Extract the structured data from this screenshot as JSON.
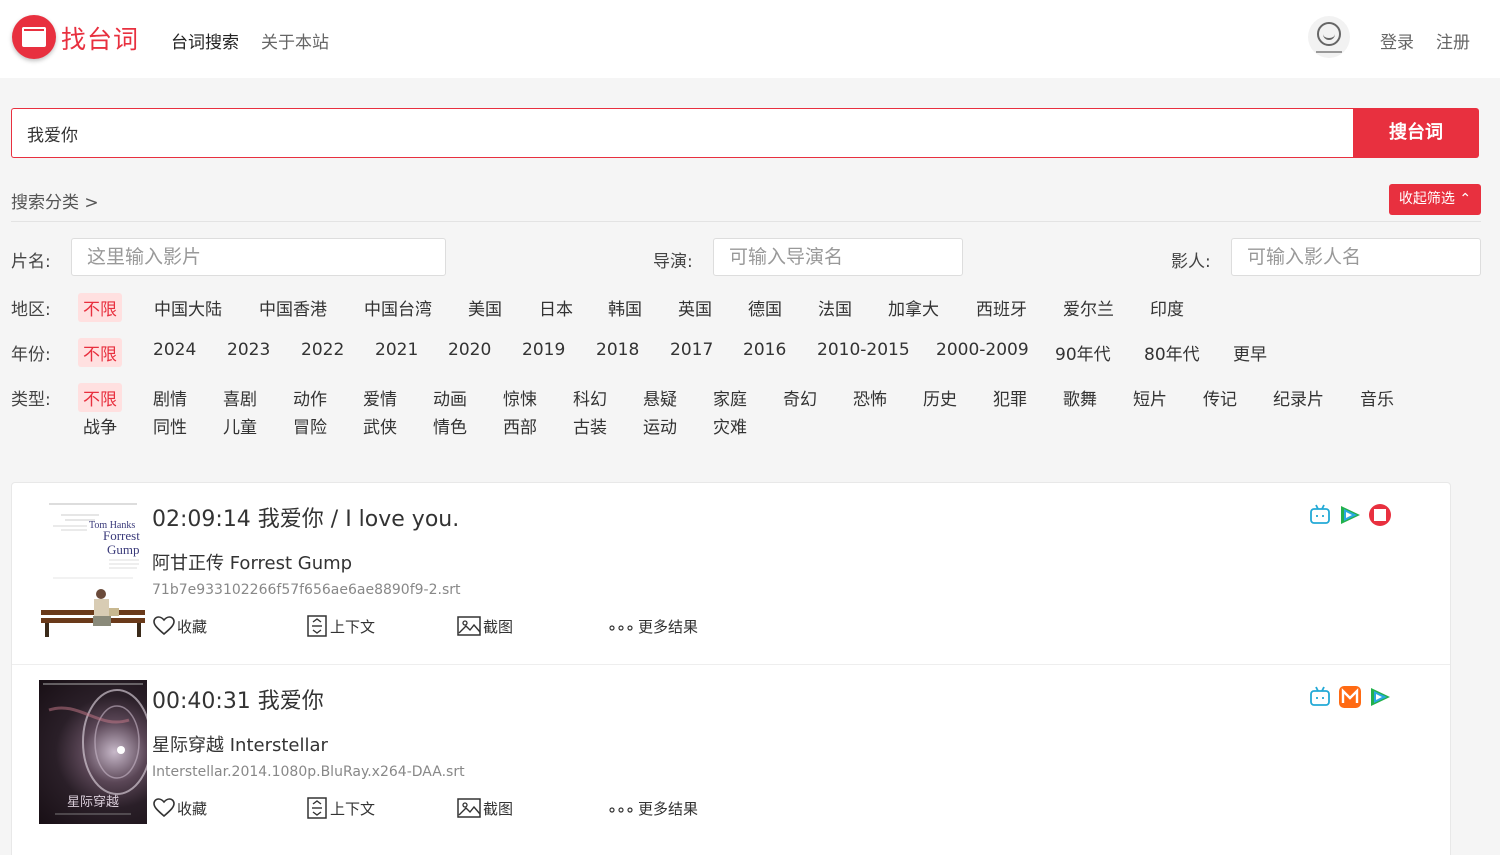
{
  "header": {
    "logo_text": "找台词",
    "nav": [
      "台词搜索",
      "关于本站"
    ],
    "login": "登录",
    "register": "注册"
  },
  "search": {
    "value": "我爱你",
    "button": "搜台词"
  },
  "filters": {
    "category_title": "搜索分类 >",
    "collapse_button": "收起筛选 ⌃",
    "title_label": "片名:",
    "title_placeholder": "这里输入影片",
    "director_label": "导演:",
    "director_placeholder": "可输入导演名",
    "actor_label": "影人:",
    "actor_placeholder": "可输入影人名",
    "region_label": "地区:",
    "regions": [
      "不限",
      "中国大陆",
      "中国香港",
      "中国台湾",
      "美国",
      "日本",
      "韩国",
      "英国",
      "德国",
      "法国",
      "加拿大",
      "西班牙",
      "爱尔兰",
      "印度"
    ],
    "year_label": "年份:",
    "years": [
      "不限",
      "2024",
      "2023",
      "2022",
      "2021",
      "2020",
      "2019",
      "2018",
      "2017",
      "2016",
      "2010-2015",
      "2000-2009",
      "90年代",
      "80年代",
      "更早"
    ],
    "genre_label": "类型:",
    "genres": [
      "不限",
      "剧情",
      "喜剧",
      "动作",
      "爱情",
      "动画",
      "惊悚",
      "科幻",
      "悬疑",
      "家庭",
      "奇幻",
      "恐怖",
      "历史",
      "犯罪",
      "歌舞",
      "短片",
      "传记",
      "纪录片",
      "音乐",
      "战争",
      "同性",
      "儿童",
      "冒险",
      "武侠",
      "情色",
      "西部",
      "古装",
      "运动",
      "灾难"
    ]
  },
  "results": [
    {
      "title": "02:09:14 我爱你 / I love you.",
      "movie": "阿甘正传 Forrest Gump",
      "file": "71b7e933102266f57f656ae6ae8890f9-2.srt",
      "poster_text": [
        "Tom Hanks",
        "Forrest",
        "Gump"
      ],
      "sources": [
        "bilibili-icon",
        "tencent-video-icon",
        "zhaotaici-icon"
      ]
    },
    {
      "title": "00:40:31 我爱你",
      "movie": "星际穿越 Interstellar",
      "file": "Interstellar.2014.1080p.BluRay.x264-DAA.srt",
      "poster_text": [
        "星际穿越"
      ],
      "sources": [
        "bilibili-icon",
        "mgtv-icon",
        "tencent-video-icon"
      ]
    }
  ],
  "actions": {
    "favorite": "收藏",
    "context": "上下文",
    "screenshot": "截图",
    "more": "更多结果"
  },
  "colors": {
    "accent": "#e8303f",
    "active_bg": "#ffe0e0"
  }
}
